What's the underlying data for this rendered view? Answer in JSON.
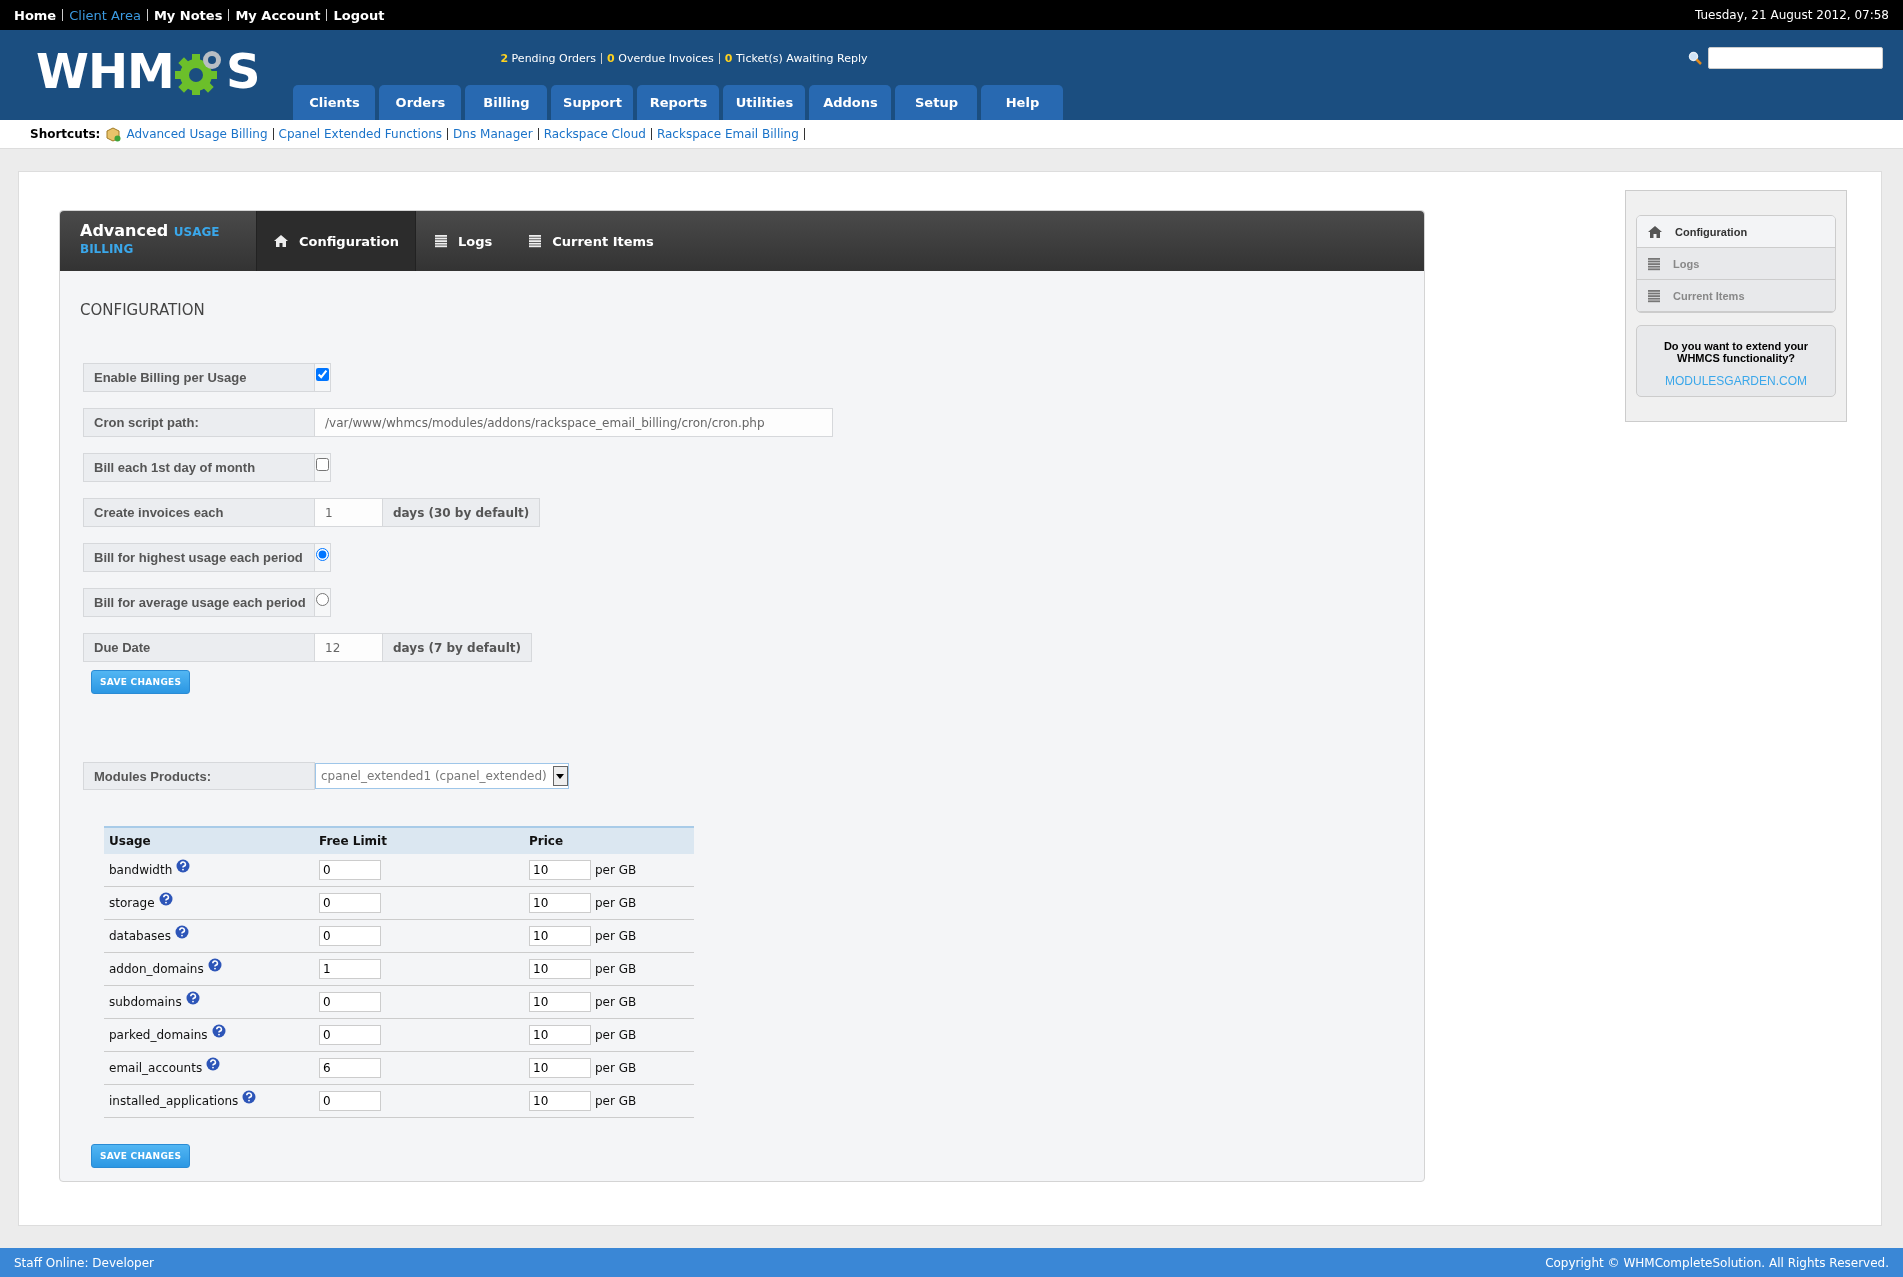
{
  "top_bar": {
    "links": [
      {
        "label": "Home",
        "selected": false
      },
      {
        "label": "Client Area",
        "selected": true
      },
      {
        "label": "My Notes",
        "selected": false
      },
      {
        "label": "My Account",
        "selected": false
      },
      {
        "label": "Logout",
        "selected": false
      }
    ],
    "datetime": "Tuesday, 21 August 2012, 07:58"
  },
  "header": {
    "logo": {
      "left": "WHM",
      "right": "S"
    },
    "notices": [
      {
        "count": "2",
        "label": "Pending Orders"
      },
      {
        "count": "0",
        "label": "Overdue Invoices"
      },
      {
        "count": "0",
        "label": "Ticket(s) Awaiting Reply"
      }
    ],
    "nav": [
      "Clients",
      "Orders",
      "Billing",
      "Support",
      "Reports",
      "Utilities",
      "Addons",
      "Setup",
      "Help"
    ]
  },
  "shortcuts": {
    "label": "Shortcuts:",
    "links": [
      "Advanced Usage Billing",
      "Cpanel Extended Functions",
      "Dns Manager",
      "Rackspace Cloud",
      "Rackspace Email Billing"
    ]
  },
  "module": {
    "title": {
      "main": "Advanced",
      "accent_1": "USAGE",
      "accent_2": "BILLING"
    },
    "tabs": [
      {
        "label": "Configuration",
        "selected": true
      },
      {
        "label": "Logs",
        "selected": false
      },
      {
        "label": "Current Items",
        "selected": false
      }
    ],
    "heading": "CONFIGURATION",
    "settings": [
      {
        "kind": "checkbox",
        "label": "Enable Billing per Usage",
        "checked": true
      },
      {
        "kind": "text",
        "label": "Cron script path:",
        "value": "/var/www/whmcs/modules/addons/rackspace_email_billing/cron/cron.php"
      },
      {
        "kind": "checkbox",
        "label": "Bill each 1st day of month",
        "checked": false
      },
      {
        "kind": "number",
        "label": "Create invoices each",
        "value": "1",
        "suffix": "days (30 by default)"
      },
      {
        "kind": "radio",
        "label": "Bill for highest usage each period",
        "selected": true
      },
      {
        "kind": "radio",
        "label": "Bill for average usage each period",
        "selected": false
      },
      {
        "kind": "number",
        "label": "Due Date",
        "value": "12",
        "suffix": "days (7 by default)"
      }
    ],
    "settings_save": "SAVE CHANGES",
    "products": {
      "label": "Modules Products:",
      "value": "cpanel_extended1 (cpanel_extended)"
    },
    "table": {
      "columns": [
        "Usage",
        "Free Limit",
        "Price"
      ],
      "rows": [
        {
          "usage": "bandwidth",
          "free_limit": "0",
          "price": "10",
          "unit": "per GB"
        },
        {
          "usage": "storage",
          "free_limit": "0",
          "price": "10",
          "unit": "per GB"
        },
        {
          "usage": "databases",
          "free_limit": "0",
          "price": "10",
          "unit": "per GB"
        },
        {
          "usage": "addon_domains",
          "free_limit": "1",
          "price": "10",
          "unit": "per GB"
        },
        {
          "usage": "subdomains",
          "free_limit": "0",
          "price": "10",
          "unit": "per GB"
        },
        {
          "usage": "parked_domains",
          "free_limit": "0",
          "price": "10",
          "unit": "per GB"
        },
        {
          "usage": "email_accounts",
          "free_limit": "6",
          "price": "10",
          "unit": "per GB"
        },
        {
          "usage": "installed_applications",
          "free_limit": "0",
          "price": "10",
          "unit": "per GB"
        }
      ]
    },
    "table_save": "SAVE CHANGES"
  },
  "sidebar": {
    "items": [
      {
        "label": "Configuration",
        "selected": true
      },
      {
        "label": "Logs",
        "selected": false
      },
      {
        "label": "Current Items",
        "selected": false
      }
    ],
    "promo": {
      "text": "Do you want to extend your WHMCS functionality?",
      "link": "MODULESGARDEN.COM"
    }
  },
  "footer": {
    "staff": "Staff Online: Developer",
    "copyright": "Copyright © WHMCompleteSolution. All Rights Reserved."
  }
}
